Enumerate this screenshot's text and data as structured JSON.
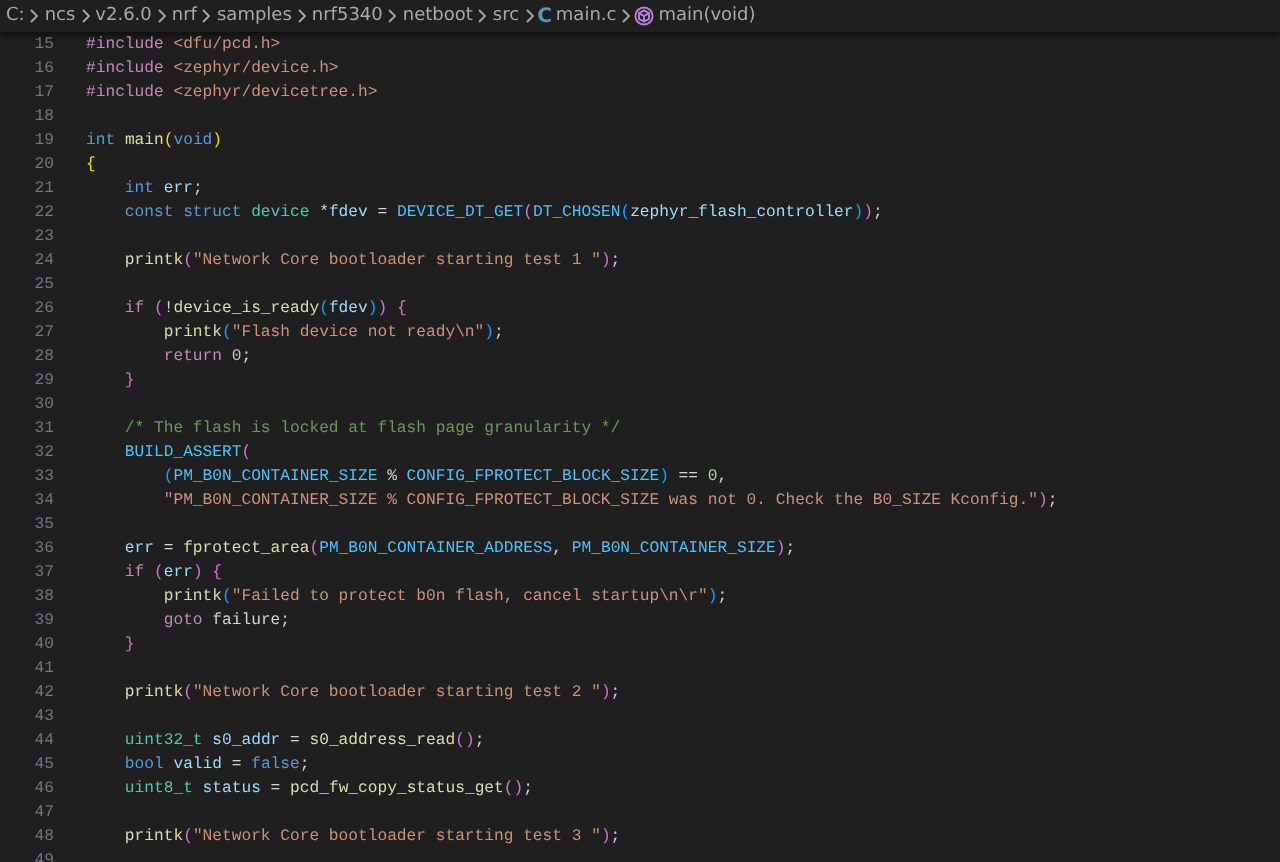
{
  "breadcrumbs": [
    {
      "kind": "folder",
      "label": "C:"
    },
    {
      "kind": "folder",
      "label": "ncs"
    },
    {
      "kind": "folder",
      "label": "v2.6.0"
    },
    {
      "kind": "folder",
      "label": "nrf"
    },
    {
      "kind": "folder",
      "label": "samples"
    },
    {
      "kind": "folder",
      "label": "nrf5340"
    },
    {
      "kind": "folder",
      "label": "netboot"
    },
    {
      "kind": "folder",
      "label": "src"
    },
    {
      "kind": "file",
      "icon": "C",
      "label": "main.c"
    },
    {
      "kind": "symbol",
      "label": "main(void)"
    }
  ],
  "lines": [
    {
      "number": "15",
      "tokens": [
        {
          "text": "#include",
          "kind": "ctl"
        },
        {
          "text": " <dfu/pcd.h>",
          "kind": "str"
        }
      ]
    },
    {
      "number": "16",
      "tokens": [
        {
          "text": "#include",
          "kind": "ctl"
        },
        {
          "text": " <zephyr/device.h>",
          "kind": "str"
        }
      ]
    },
    {
      "number": "17",
      "tokens": [
        {
          "text": "#include",
          "kind": "ctl"
        },
        {
          "text": " <zephyr/devicetree.h>",
          "kind": "str"
        }
      ]
    },
    {
      "number": "18"
    },
    {
      "number": "19",
      "tokens": [
        {
          "text": "int ",
          "kind": "kw"
        },
        {
          "text": "main",
          "kind": "fn"
        },
        {
          "text": "(",
          "kind": "b1"
        },
        {
          "text": "void",
          "kind": "kw"
        },
        {
          "text": ")",
          "kind": "b1"
        }
      ]
    },
    {
      "number": "20",
      "tokens": [
        {
          "text": "{",
          "kind": "b1"
        }
      ]
    },
    {
      "number": "21",
      "tokens": [
        {
          "text": "    int ",
          "kind": "kw"
        },
        {
          "text": "err",
          "kind": "var"
        },
        {
          "text": ";",
          "kind": "plain"
        }
      ]
    },
    {
      "number": "22",
      "tokens": [
        {
          "text": "    const struct ",
          "kind": "kw"
        },
        {
          "text": "device",
          "kind": "type"
        },
        {
          "text": " *",
          "kind": "plain"
        },
        {
          "text": "fdev",
          "kind": "var"
        },
        {
          "text": " = ",
          "kind": "plain"
        },
        {
          "text": "DEVICE_DT_GET",
          "kind": "macro"
        },
        {
          "text": "(",
          "kind": "b2"
        },
        {
          "text": "DT_CHOSEN",
          "kind": "macro"
        },
        {
          "text": "(",
          "kind": "b3"
        },
        {
          "text": "zephyr_flash_controller",
          "kind": "var"
        },
        {
          "text": ")",
          "kind": "b3"
        },
        {
          "text": ")",
          "kind": "b2"
        },
        {
          "text": ";",
          "kind": "plain"
        }
      ]
    },
    {
      "number": "23"
    },
    {
      "number": "24",
      "tokens": [
        {
          "text": "    printk",
          "kind": "fn"
        },
        {
          "text": "(",
          "kind": "b2"
        },
        {
          "text": "\"Network Core bootloader starting test 1 \"",
          "kind": "str"
        },
        {
          "text": ")",
          "kind": "b2"
        },
        {
          "text": ";",
          "kind": "plain"
        }
      ]
    },
    {
      "number": "25"
    },
    {
      "number": "26",
      "tokens": [
        {
          "text": "    if ",
          "kind": "ctl"
        },
        {
          "text": "(",
          "kind": "b2"
        },
        {
          "text": "!",
          "kind": "plain"
        },
        {
          "text": "device_is_ready",
          "kind": "fn"
        },
        {
          "text": "(",
          "kind": "b3"
        },
        {
          "text": "fdev",
          "kind": "var"
        },
        {
          "text": ")",
          "kind": "b3"
        },
        {
          "text": ") ",
          "kind": "b2"
        },
        {
          "text": "{",
          "kind": "b2"
        }
      ]
    },
    {
      "number": "27",
      "tokens": [
        {
          "text": "        printk",
          "kind": "fn"
        },
        {
          "text": "(",
          "kind": "b3"
        },
        {
          "text": "\"Flash device not ready\\n\"",
          "kind": "str"
        },
        {
          "text": ")",
          "kind": "b3"
        },
        {
          "text": ";",
          "kind": "plain"
        }
      ]
    },
    {
      "number": "28",
      "tokens": [
        {
          "text": "        return ",
          "kind": "ctl"
        },
        {
          "text": "0",
          "kind": "num"
        },
        {
          "text": ";",
          "kind": "plain"
        }
      ]
    },
    {
      "number": "29",
      "tokens": [
        {
          "text": "    }",
          "kind": "b2"
        }
      ]
    },
    {
      "number": "30"
    },
    {
      "number": "31",
      "tokens": [
        {
          "text": "    /* The flash is locked at flash page granularity */",
          "kind": "cmt"
        }
      ]
    },
    {
      "number": "32",
      "tokens": [
        {
          "text": "    BUILD_ASSERT",
          "kind": "macro"
        },
        {
          "text": "(",
          "kind": "b2"
        }
      ]
    },
    {
      "number": "33",
      "tokens": [
        {
          "text": "        (",
          "kind": "b3"
        },
        {
          "text": "PM_B0N_CONTAINER_SIZE",
          "kind": "macro"
        },
        {
          "text": " % ",
          "kind": "plain"
        },
        {
          "text": "CONFIG_FPROTECT_BLOCK_SIZE",
          "kind": "macro"
        },
        {
          "text": ")",
          "kind": "b3"
        },
        {
          "text": " == ",
          "kind": "plain"
        },
        {
          "text": "0",
          "kind": "num"
        },
        {
          "text": ",",
          "kind": "plain"
        }
      ]
    },
    {
      "number": "34",
      "tokens": [
        {
          "text": "        \"PM_B0N_CONTAINER_SIZE % CONFIG_FPROTECT_BLOCK_SIZE was not 0. Check the B0_SIZE Kconfig.\"",
          "kind": "str"
        },
        {
          "text": ")",
          "kind": "b2"
        },
        {
          "text": ";",
          "kind": "plain"
        }
      ]
    },
    {
      "number": "35"
    },
    {
      "number": "36",
      "tokens": [
        {
          "text": "    err",
          "kind": "var"
        },
        {
          "text": " = ",
          "kind": "plain"
        },
        {
          "text": "fprotect_area",
          "kind": "fn"
        },
        {
          "text": "(",
          "kind": "b2"
        },
        {
          "text": "PM_B0N_CONTAINER_ADDRESS",
          "kind": "macro"
        },
        {
          "text": ", ",
          "kind": "plain"
        },
        {
          "text": "PM_B0N_CONTAINER_SIZE",
          "kind": "macro"
        },
        {
          "text": ")",
          "kind": "b2"
        },
        {
          "text": ";",
          "kind": "plain"
        }
      ]
    },
    {
      "number": "37",
      "tokens": [
        {
          "text": "    if ",
          "kind": "ctl"
        },
        {
          "text": "(",
          "kind": "b2"
        },
        {
          "text": "err",
          "kind": "var"
        },
        {
          "text": ") ",
          "kind": "b2"
        },
        {
          "text": "{",
          "kind": "b2"
        }
      ]
    },
    {
      "number": "38",
      "tokens": [
        {
          "text": "        printk",
          "kind": "fn"
        },
        {
          "text": "(",
          "kind": "b3"
        },
        {
          "text": "\"Failed to protect b0n flash, cancel startup\\n\\r\"",
          "kind": "str"
        },
        {
          "text": ")",
          "kind": "b3"
        },
        {
          "text": ";",
          "kind": "plain"
        }
      ]
    },
    {
      "number": "39",
      "tokens": [
        {
          "text": "        goto",
          "kind": "ctl"
        },
        {
          "text": " failure;",
          "kind": "plain"
        }
      ]
    },
    {
      "number": "40",
      "tokens": [
        {
          "text": "    }",
          "kind": "b2"
        }
      ]
    },
    {
      "number": "41"
    },
    {
      "number": "42",
      "tokens": [
        {
          "text": "    printk",
          "kind": "fn"
        },
        {
          "text": "(",
          "kind": "b2"
        },
        {
          "text": "\"Network Core bootloader starting test 2 \"",
          "kind": "str"
        },
        {
          "text": ")",
          "kind": "b2"
        },
        {
          "text": ";",
          "kind": "plain"
        }
      ]
    },
    {
      "number": "43"
    },
    {
      "number": "44",
      "tokens": [
        {
          "text": "    uint32_t ",
          "kind": "type"
        },
        {
          "text": "s0_addr",
          "kind": "var"
        },
        {
          "text": " = ",
          "kind": "plain"
        },
        {
          "text": "s0_address_read",
          "kind": "fn"
        },
        {
          "text": "()",
          "kind": "b2"
        },
        {
          "text": ";",
          "kind": "plain"
        }
      ]
    },
    {
      "number": "45",
      "tokens": [
        {
          "text": "    bool ",
          "kind": "kw"
        },
        {
          "text": "valid",
          "kind": "var"
        },
        {
          "text": " = ",
          "kind": "plain"
        },
        {
          "text": "false",
          "kind": "kw"
        },
        {
          "text": ";",
          "kind": "plain"
        }
      ]
    },
    {
      "number": "46",
      "tokens": [
        {
          "text": "    uint8_t ",
          "kind": "type"
        },
        {
          "text": "status",
          "kind": "var"
        },
        {
          "text": " = ",
          "kind": "plain"
        },
        {
          "text": "pcd_fw_copy_status_get",
          "kind": "fn"
        },
        {
          "text": "()",
          "kind": "b2"
        },
        {
          "text": ";",
          "kind": "plain"
        }
      ]
    },
    {
      "number": "47"
    },
    {
      "number": "48",
      "tokens": [
        {
          "text": "    printk",
          "kind": "fn"
        },
        {
          "text": "(",
          "kind": "b2"
        },
        {
          "text": "\"Network Core bootloader starting test 3 \"",
          "kind": "str"
        },
        {
          "text": ")",
          "kind": "b2"
        },
        {
          "text": ";",
          "kind": "plain"
        }
      ]
    },
    {
      "number": "49"
    }
  ]
}
